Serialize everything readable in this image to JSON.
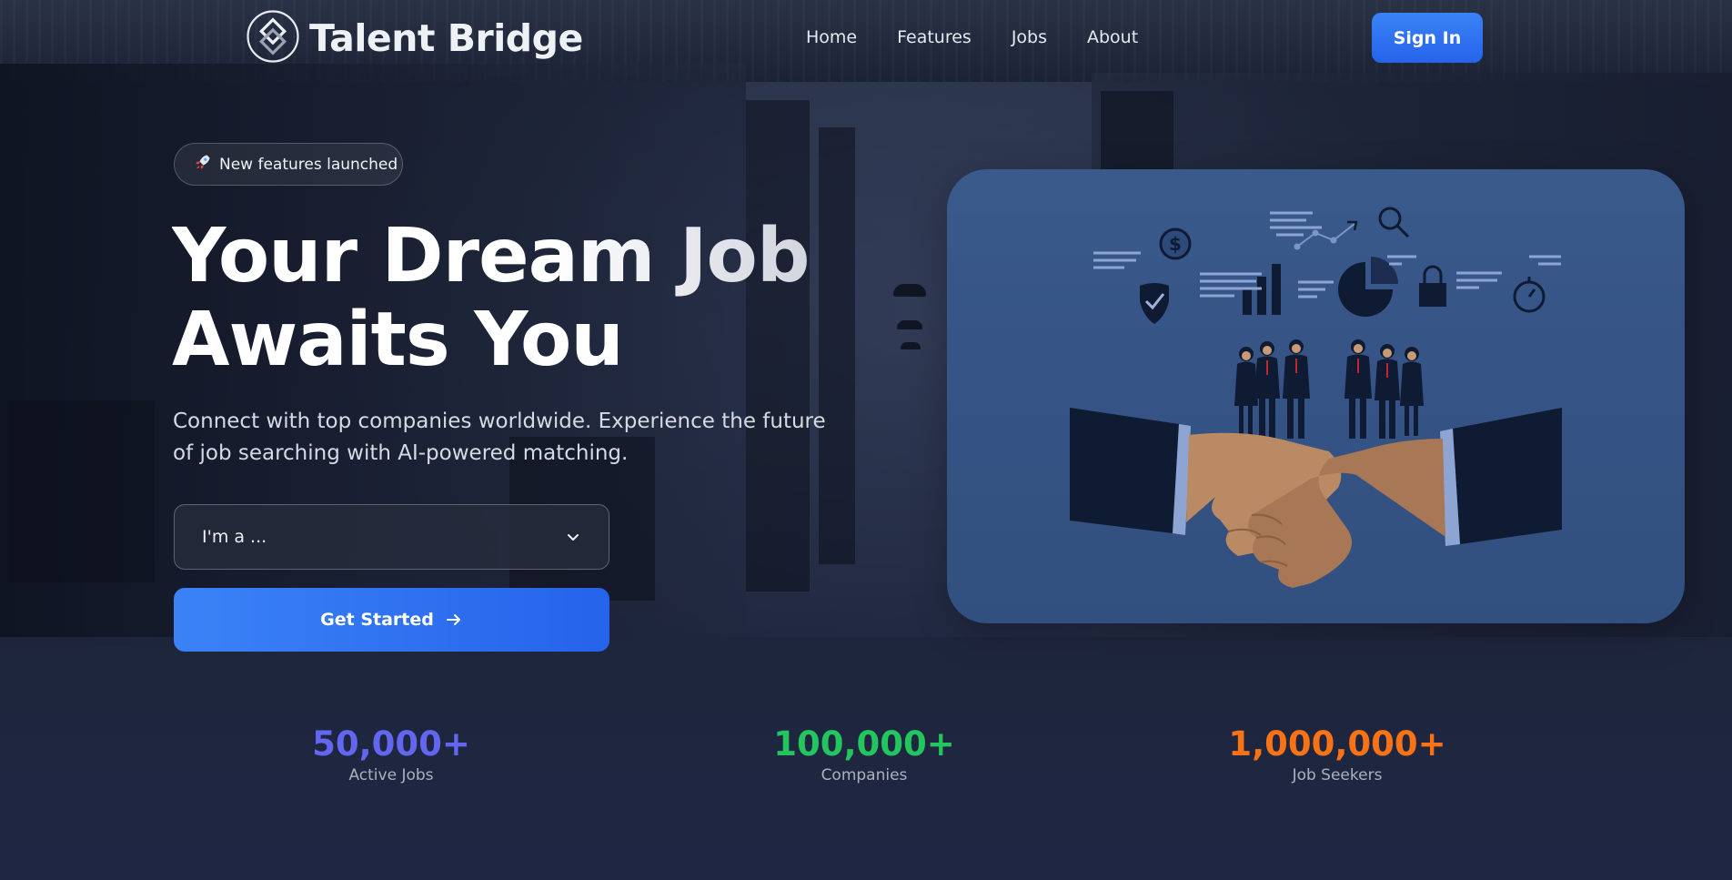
{
  "brand": {
    "name": "Talent Bridge",
    "logo_icon": "interlocking-square-logo"
  },
  "nav": {
    "items": [
      {
        "label": "Home"
      },
      {
        "label": "Features"
      },
      {
        "label": "Jobs"
      },
      {
        "label": "About"
      }
    ],
    "signin_label": "Sign In"
  },
  "hero": {
    "badge": {
      "icon": "rocket-icon",
      "label": "New features launched"
    },
    "title_line1": "Your Dream Job",
    "title_line2": "Awaits You",
    "subtitle": "Connect with top companies worldwide. Experience the future of job searching with AI-powered matching.",
    "select": {
      "value": "I'm a ...",
      "icon": "chevron-down-icon"
    },
    "cta": {
      "label": "Get Started",
      "icon": "arrow-right-icon"
    }
  },
  "illustration": {
    "description_icon": "handshake-business-team-illustration"
  },
  "stats": [
    {
      "value": "50,000+",
      "label": "Active Jobs",
      "color": "#6366f1"
    },
    {
      "value": "100,000+",
      "label": "Companies",
      "color": "#22c55e"
    },
    {
      "value": "1,000,000+",
      "label": "Job Seekers",
      "color": "#f97316"
    }
  ],
  "colors": {
    "accent": "#3b82f6",
    "background": "#1a2238",
    "card": "#355384"
  }
}
